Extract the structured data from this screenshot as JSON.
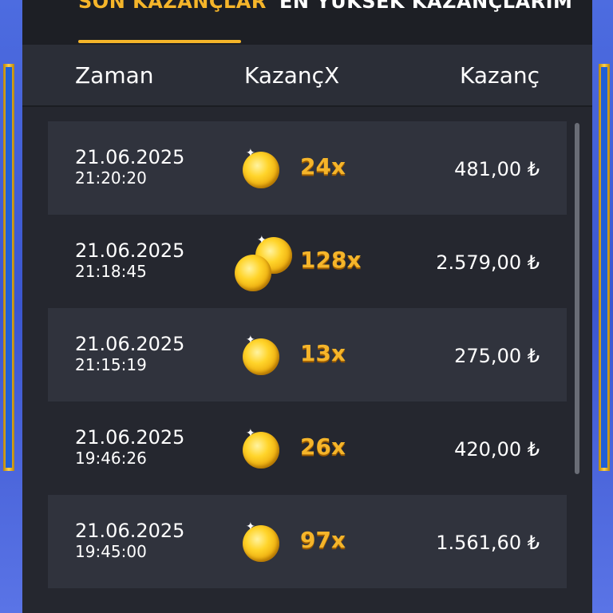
{
  "tabs": {
    "recent": "SON KAZANÇLAR",
    "top": "EN YÜKSEK KAZANÇLARIM"
  },
  "columns": {
    "time": "Zaman",
    "multiplier": "KazançX",
    "win": "Kazanç"
  },
  "rows": [
    {
      "date": "21.06.2025",
      "time": "21:20:20",
      "multiplier": "24x",
      "win": "481,00 ₺",
      "coins": 1
    },
    {
      "date": "21.06.2025",
      "time": "21:18:45",
      "multiplier": "128x",
      "win": "2.579,00 ₺",
      "coins": 2
    },
    {
      "date": "21.06.2025",
      "time": "21:15:19",
      "multiplier": "13x",
      "win": "275,00 ₺",
      "coins": 1
    },
    {
      "date": "21.06.2025",
      "time": "19:46:26",
      "multiplier": "26x",
      "win": "420,00 ₺",
      "coins": 1
    },
    {
      "date": "21.06.2025",
      "time": "19:45:00",
      "multiplier": "97x",
      "win": "1.561,60 ₺",
      "coins": 1
    }
  ],
  "colors": {
    "accent": "#f5b52a",
    "panel": "#25272f"
  },
  "icons": [
    "coin-icon",
    "coin-stack-icon"
  ]
}
